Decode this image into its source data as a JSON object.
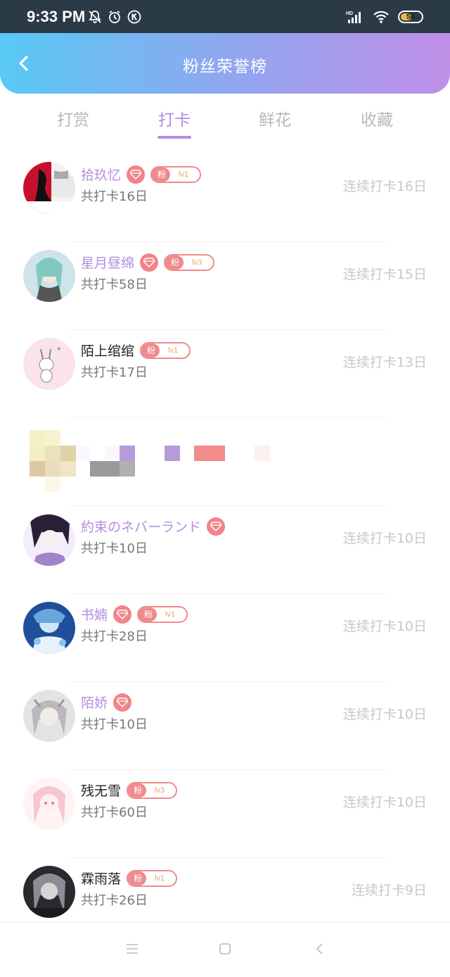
{
  "status": {
    "time": "9:33 PM",
    "battery": "54",
    "battery_level": 0.54,
    "icons": [
      "mute-icon",
      "alarm-icon",
      "k-icon",
      "hd-signal-icon",
      "wifi-icon",
      "battery-icon"
    ]
  },
  "header": {
    "title": "粉丝荣誉榜"
  },
  "tabs": [
    {
      "label": "打赏"
    },
    {
      "label": "打卡"
    },
    {
      "label": "鲜花"
    },
    {
      "label": "收藏"
    }
  ],
  "active_tab": "打卡",
  "rows": [
    {
      "name": "拾玖忆",
      "vip": true,
      "fan_badge": true,
      "fan_label": "粉",
      "level": "lv1",
      "total": "共打卡16日",
      "streak": "连续打卡16日"
    },
    {
      "name": "星月昼绵",
      "vip": true,
      "fan_badge": true,
      "fan_label": "粉",
      "level": "lv3",
      "total": "共打卡58日",
      "streak": "连续打卡15日"
    },
    {
      "name": "陌上绾绾",
      "vip": false,
      "fan_badge": true,
      "fan_label": "粉",
      "level": "lv1",
      "total": "共打卡17日",
      "streak": "连续打卡13日"
    },
    {
      "name": "約束のネバーランド",
      "vip": true,
      "fan_badge": false,
      "total": "共打卡10日",
      "streak": "连续打卡10日"
    },
    {
      "name": "书婻",
      "vip": true,
      "fan_badge": true,
      "fan_label": "粉",
      "level": "lv1",
      "total": "共打卡28日",
      "streak": "连续打卡10日"
    },
    {
      "name": "陌娇",
      "vip": true,
      "fan_badge": false,
      "total": "共打卡10日",
      "streak": "连续打卡10日"
    },
    {
      "name": "残无雪",
      "vip": false,
      "fan_badge": true,
      "fan_label": "粉",
      "level": "lv3",
      "total": "共打卡60日",
      "streak": "连续打卡10日"
    },
    {
      "name": "霖雨落",
      "vip": false,
      "fan_badge": true,
      "fan_label": "粉",
      "level": "lv1",
      "total": "共打卡26日",
      "streak": "连续打卡9日"
    }
  ],
  "colors": {
    "accent": "#b48de0",
    "header_gradient": [
      "#57c9f4",
      "#c08fe8"
    ],
    "badge": "#ef8a8d"
  }
}
